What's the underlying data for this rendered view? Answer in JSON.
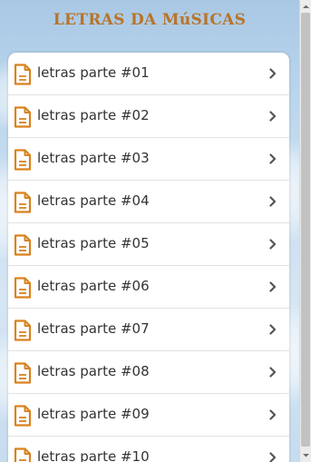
{
  "header": {
    "title": "LETRAS DA MúSICAS"
  },
  "list": {
    "items": [
      {
        "label": "letras parte #01",
        "icon": "document-icon"
      },
      {
        "label": "letras parte #02",
        "icon": "document-icon"
      },
      {
        "label": "letras parte #03",
        "icon": "document-icon"
      },
      {
        "label": "letras parte #04",
        "icon": "document-icon"
      },
      {
        "label": "letras parte #05",
        "icon": "document-icon"
      },
      {
        "label": "letras parte #06",
        "icon": "document-icon"
      },
      {
        "label": "letras parte #07",
        "icon": "document-icon"
      },
      {
        "label": "letras parte #08",
        "icon": "document-icon"
      },
      {
        "label": "letras parte #09",
        "icon": "document-icon"
      },
      {
        "label": "letras parte #10",
        "icon": "document-icon"
      }
    ]
  },
  "colors": {
    "title": "#b8742a",
    "icon": "#d9821e",
    "label": "#333333",
    "chevron": "#555555"
  }
}
